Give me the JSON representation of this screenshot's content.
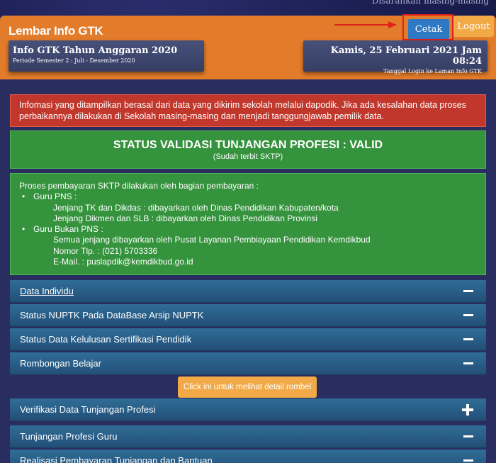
{
  "top_text": "Disarankan masing-masing",
  "header": {
    "title": "Lembar Info GTK",
    "cetak_label": "Cetak",
    "logout_label": "Logout",
    "left_box": {
      "title": "Info GTK Tahun Anggaran 2020",
      "subtitle": "Periode Semester 2 : Juli - Desember 2020"
    },
    "right_box": {
      "title": "Kamis, 25 Februari 2021 Jam 08:24",
      "subtitle": "Tanggal Login ke Laman Info GTK"
    }
  },
  "alert": {
    "line1": "Infomasi yang ditampilkan berasal dari data yang dikirim sekolah melalui dapodik. Jika ada kesalahan data proses",
    "line2": "perbaikannya dilakukan di Sekolah masing-masing dan menjadi tanggungjawab pemilik data."
  },
  "status": {
    "heading": "STATUS VALIDASI TUNJANGAN PROFESI : VALID",
    "sub": "(Sudah terbit SKTP)"
  },
  "process": {
    "intro": "Proses pembayaran SKTP dilakukan oleh bagian pembayaran :",
    "pns_label": "Guru PNS :",
    "pns_line1": "Jenjang TK dan Dikdas : dibayarkan oleh Dinas Pendidikan Kabupaten/kota",
    "pns_line2": "Jenjang Dikmen dan SLB : dibayarkan oleh Dinas Pendidikan Provinsi",
    "nonpns_label": "Guru Bukan PNS :",
    "nonpns_line1": "Semua jenjang dibayarkan oleh Pusat Layanan Pembiayaan Pendidikan Kemdikbud",
    "nonpns_line2": "Nomor Tlp. : (021) 5703336",
    "nonpns_line3": "E-Mail. : puslapdik@kemdikbud.go.id"
  },
  "accordion": {
    "item1": "Data Individu",
    "item2": "Status NUPTK Pada DataBase Arsip NUPTK",
    "item3": "Status Data Kelulusan Sertifikasi Pendidik",
    "item4": "Rombongan Belajar",
    "rombel_button": "Click ini untuk melihat detail rombel",
    "item5": "Verifikasi Data Tunjangan Profesi",
    "item6": "Tunjangan Profesi Guru",
    "item7": "Realisasi Pembayaran Tunjangan dan Bantuan"
  },
  "colors": {
    "header_bg": "#e27c2b",
    "cetak_bg": "#2f78c4",
    "logout_bg": "#f2a948",
    "alert_bg": "#c2372b",
    "status_bg": "#35923d",
    "accordion_bg": "#2f6d97",
    "highlight": "#e0201c"
  }
}
